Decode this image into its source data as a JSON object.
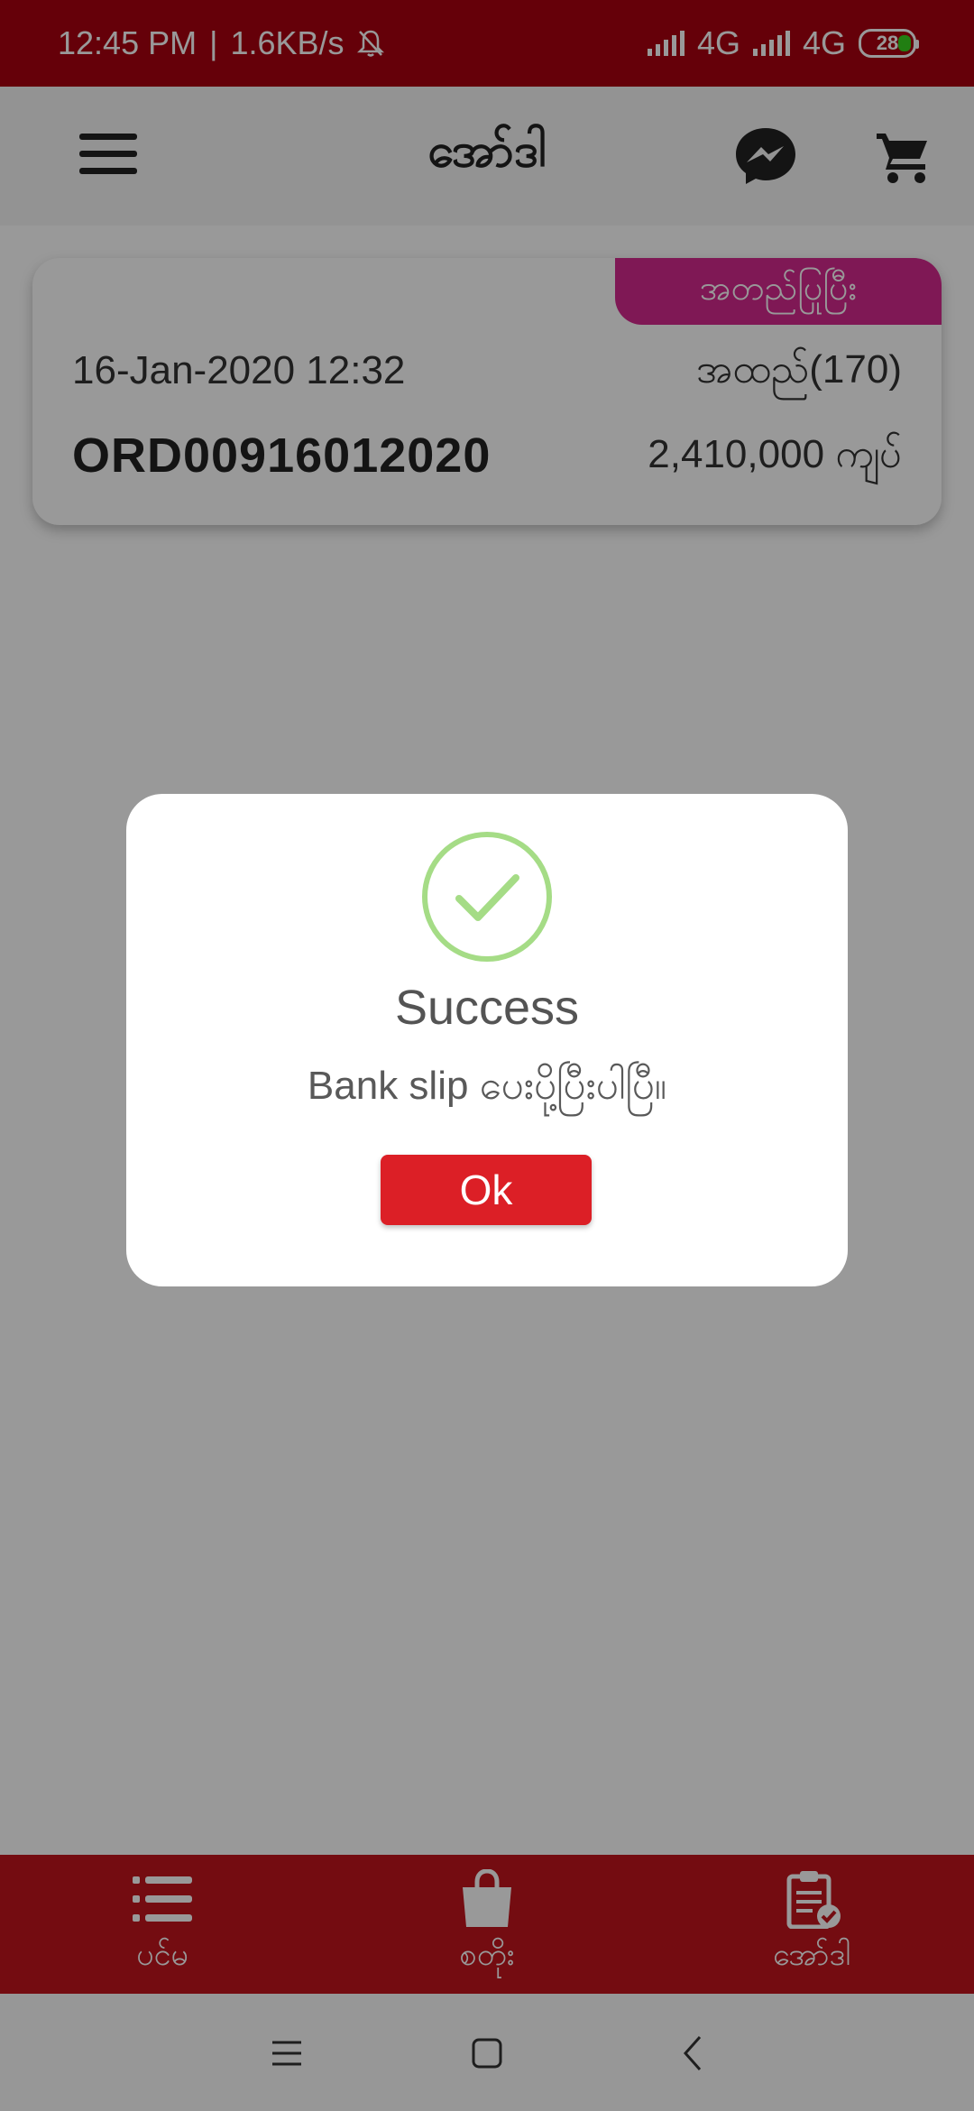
{
  "status_bar": {
    "time": "12:45  PM",
    "divider": "|",
    "speed": "1.6KB/s",
    "network1": "4G",
    "network2": "4G",
    "battery": "28"
  },
  "app_bar": {
    "title": "အော်ဒါ"
  },
  "order": {
    "status_badge": "အတည်ပြုပြီး",
    "date": "16-Jan-2020 12:32",
    "item_count": "အထည်(170)",
    "order_id": "ORD00916012020",
    "total": "2,410,000 ကျပ်"
  },
  "bottom_nav": {
    "items": [
      {
        "label": "ပင်မ",
        "icon": "list-icon"
      },
      {
        "label": "စတိုး",
        "icon": "shopping-bag-icon"
      },
      {
        "label": "အော်ဒါ",
        "icon": "clipboard-check-icon"
      }
    ]
  },
  "dialog": {
    "title": "Success",
    "message": "Bank slip ပေးပို့ပြီးပါပြီ။",
    "ok_label": "Ok"
  },
  "colors": {
    "status_bar": "#a8010f",
    "bottom_nav": "#c1141d",
    "badge": "#d4288e",
    "success_ring": "#a5dc86",
    "ok_button": "#dc1f26"
  }
}
